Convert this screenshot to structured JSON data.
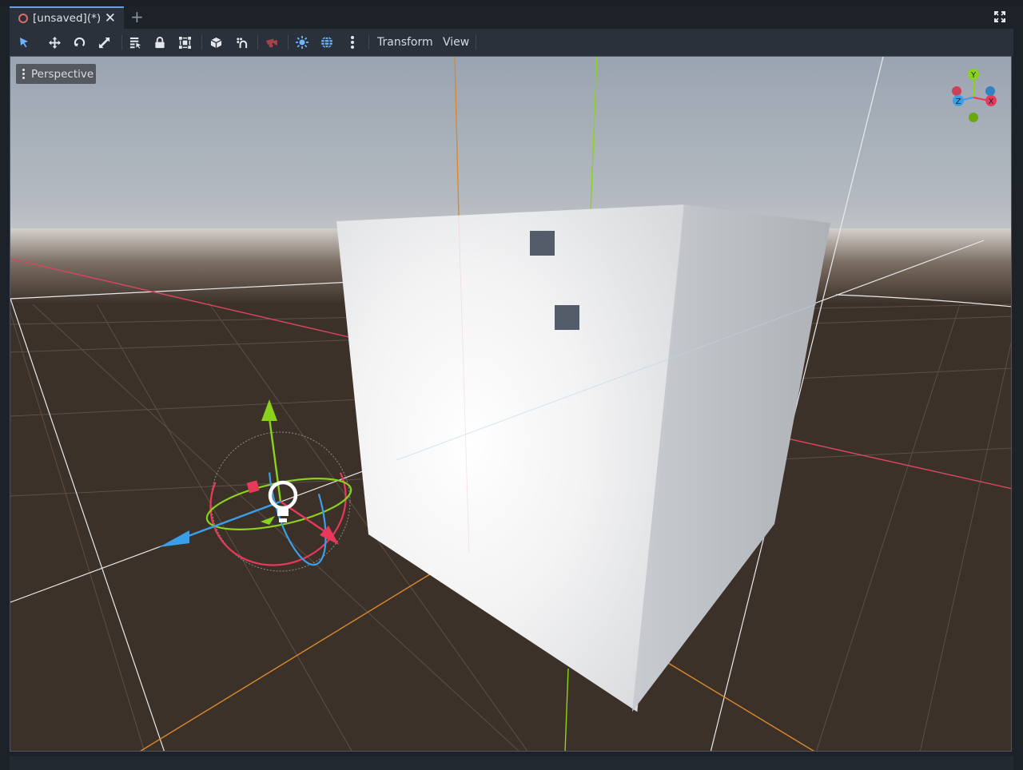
{
  "tab": {
    "title": "[unsaved](*)",
    "close_glyph": "✕"
  },
  "new_tab_glyph": "+",
  "toolbar": {
    "tools": [
      "select-icon",
      "move-icon",
      "rotate-icon",
      "scale-icon",
      "list-select-icon",
      "lock-icon",
      "group-icon",
      "local-space-icon",
      "snap-icon",
      "camera-icon",
      "sun-icon",
      "environment-icon",
      "more-icon"
    ],
    "menus": {
      "transform": "Transform",
      "view": "View"
    }
  },
  "viewport": {
    "perspective_label": "Perspective",
    "gizmo": {
      "y_label": "Y",
      "z_label": "Z",
      "x_label": "X"
    }
  },
  "colors": {
    "accent": "#6d9ed9",
    "x_axis": "#e8395a",
    "y_axis": "#8ad21c",
    "z_axis": "#3a9fe8",
    "floor": "#3c3129",
    "sky": "#9aa3ae"
  }
}
